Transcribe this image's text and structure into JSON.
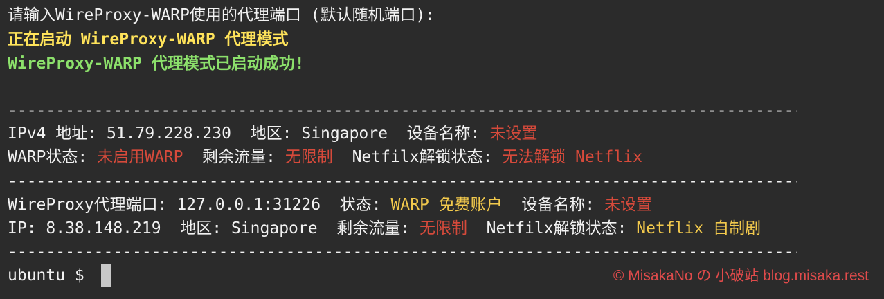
{
  "terminal": {
    "lines": {
      "prompt_port": "请输入WireProxy-WARP使用的代理端口 (默认随机端口):",
      "starting": "正在启动 WireProxy-WARP 代理模式",
      "success": "WireProxy-WARP 代理模式已启动成功!"
    },
    "separator": "-----------------------------------------------------------------------------------",
    "ipv4_row": {
      "label": "IPv4 地址: ",
      "address": "51.79.228.230",
      "region_label": "  地区: ",
      "region": "Singapore",
      "device_label": "  设备名称: ",
      "device_value": "未设置"
    },
    "warp_row": {
      "status_label": "WARP状态: ",
      "status_value": "未启用WARP",
      "traffic_label": "  剩余流量: ",
      "traffic_value": "无限制",
      "netflix_label": "  Netfilx解锁状态: ",
      "netflix_value": "无法解锁 Netflix"
    },
    "proxy_row": {
      "port_label": "WireProxy代理端口: ",
      "port_value": "127.0.0.1:31226",
      "status_label": "  状态: ",
      "status_value": "WARP 免费账户",
      "device_label": "  设备名称: ",
      "device_value": "未设置"
    },
    "ip_row": {
      "label": "IP: ",
      "address": "8.38.148.219",
      "region_label": "  地区: ",
      "region": "Singapore",
      "traffic_label": "  剩余流量: ",
      "traffic_value": "无限制",
      "netflix_label": "  Netfilx解锁状态: ",
      "netflix_value": "Netflix 自制剧"
    },
    "shell_prompt": "ubuntu $ "
  },
  "watermark": "© MisakaNo の 小破站 blog.misaka.rest",
  "colors": {
    "background": "#2b2b2b",
    "text": "#f2f2f2",
    "error_red": "#d64a3b",
    "warning_yellow": "#f2c94c",
    "success_green": "#8ce06b",
    "watermark_red": "#e04b4b"
  }
}
